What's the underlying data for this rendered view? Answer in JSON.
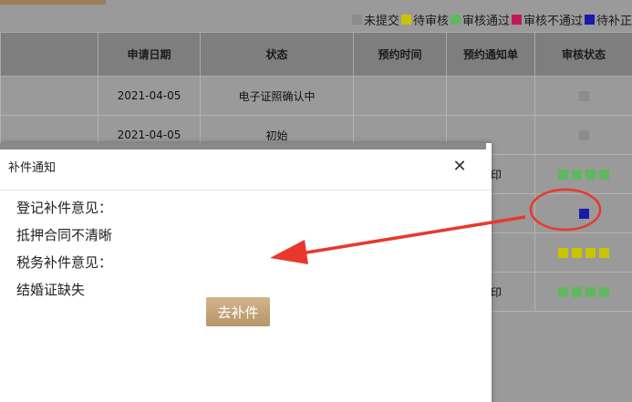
{
  "legend": [
    {
      "label": "未提交",
      "color": "#8c8c8c"
    },
    {
      "label": "待审核",
      "color": "#c8c400"
    },
    {
      "label": "审核通过",
      "color": "#5fb85f"
    },
    {
      "label": "审核不通过",
      "color": "#c2185b"
    },
    {
      "label": "待补正",
      "color": "#1a1aaa"
    }
  ],
  "table": {
    "headers": [
      "申请日期",
      "状态",
      "预约时间",
      "预约通知单",
      "审核状态"
    ],
    "rows": [
      {
        "date": "2021-04-05",
        "status": "电子证照确认中",
        "time": "",
        "notice": "",
        "audit": [
          "#8c8c8c"
        ]
      },
      {
        "date": "2021-04-05",
        "status": "初始",
        "time": "",
        "notice": "",
        "audit": [
          "#8c8c8c"
        ]
      },
      {
        "date": "",
        "status": "",
        "time": "",
        "notice": "打印",
        "audit": [
          "#5fb85f",
          "#5fb85f",
          "#5fb85f",
          "#5fb85f"
        ]
      },
      {
        "date": "",
        "status": "",
        "time": "",
        "notice": "",
        "audit": [
          "#1a1aaa"
        ]
      },
      {
        "date": "",
        "status": "",
        "time": "",
        "notice": "",
        "audit": [
          "#c8c400",
          "#c8c400",
          "#c8c400",
          "#c8c400"
        ]
      },
      {
        "date": "",
        "status": "",
        "time": "",
        "notice": "打印",
        "audit": [
          "#5fb85f",
          "#5fb85f",
          "#5fb85f",
          "#5fb85f"
        ]
      }
    ]
  },
  "modal": {
    "title": "补件通知",
    "close_label": "✕",
    "lines": [
      "登记补件意见：",
      "抵押合同不清晰",
      "税务补件意见：",
      "结婚证缺失"
    ],
    "button_label": "去补件"
  },
  "annotation": {
    "color": "#e8382e"
  }
}
